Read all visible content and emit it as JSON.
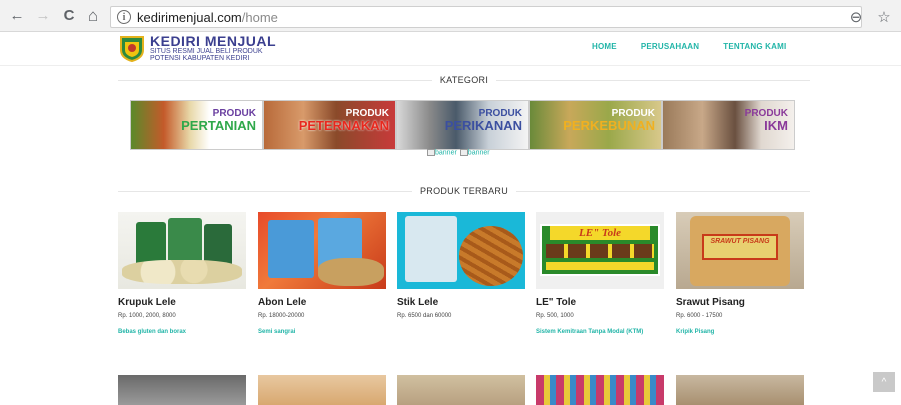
{
  "browser": {
    "url_domain": "kedirimenjual.com",
    "url_path": "/home",
    "back_icon": "←",
    "forward_icon": "→",
    "reload_icon": "C",
    "home_icon": "⌂",
    "info_icon": "i",
    "zoom_icon": "⊖",
    "star_icon": "☆"
  },
  "site": {
    "logo_title": "KEDIRI MENJUAL",
    "logo_sub1": "SITUS RESMI JUAL BELI PRODUK",
    "logo_sub2": "POTENSI KABUPATEN KEDIRI",
    "menu": [
      "HOME",
      "PERUSAHAAN",
      "TENTANG KAMI"
    ]
  },
  "kategori": {
    "title": "KATEGORI",
    "banners": [
      {
        "l1": "PRODUK",
        "l2": "PERTANIAN"
      },
      {
        "l1": "PRODUK",
        "l2": "PETERNAKAN"
      },
      {
        "l1": "PRODUK",
        "l2": "PERIKANAN"
      },
      {
        "l1": "PRODUK",
        "l2": "PERKEBUNAN"
      },
      {
        "l1": "PRODUK",
        "l2": "IKM"
      }
    ],
    "broken_1": "banner",
    "broken_2": "banner"
  },
  "produk_terbaru": {
    "title": "PRODUK TERBARU",
    "items": [
      {
        "name": "Krupuk Lele",
        "price": "Rp. 1000, 2000, 8000",
        "desc": "Bebas gluten dan borax"
      },
      {
        "name": "Abon Lele",
        "price": "Rp. 18000-20000",
        "desc": "Semi sangrai"
      },
      {
        "name": "Stik Lele",
        "price": "Rp. 6500 dan 60000",
        "desc": ""
      },
      {
        "name": "LE\" Tole",
        "price": "Rp. 500, 1000",
        "desc": "Sistem Kemitraan Tanpa Modal (KTM)"
      },
      {
        "name": "Srawut Pisang",
        "price": "Rp. 6000 - 17500",
        "desc": "Kripik Pisang"
      }
    ],
    "letole_badge": "LE\" Tole",
    "srawut_label": "SRAWUT PISANG"
  },
  "scroll_top_icon": "^"
}
